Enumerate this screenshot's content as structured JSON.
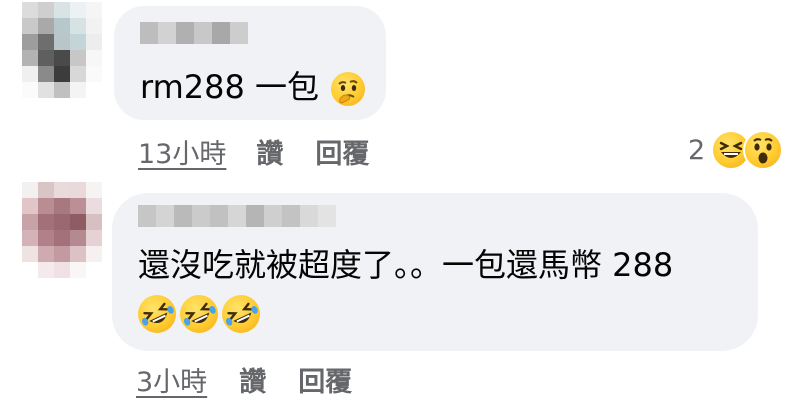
{
  "comments": [
    {
      "text": "rm288 一包",
      "emojis": [
        "thinking-face"
      ],
      "time": "13小時",
      "like_label": "讚",
      "reply_label": "回覆",
      "reaction_count": "2",
      "reactions": [
        "laughing-face",
        "wow-face"
      ]
    },
    {
      "text": "還沒吃就被超度了。。一包還馬幣 288",
      "emojis": [
        "rolling-on-floor-laughing",
        "rolling-on-floor-laughing",
        "rolling-on-floor-laughing"
      ],
      "time": "3小時",
      "like_label": "讚",
      "reply_label": "回覆"
    }
  ],
  "colors": {
    "bubble": "#f0f2f5",
    "meta_text": "#65676b",
    "body_text": "#050505",
    "emoji_yellow": "#ffcb2f"
  }
}
